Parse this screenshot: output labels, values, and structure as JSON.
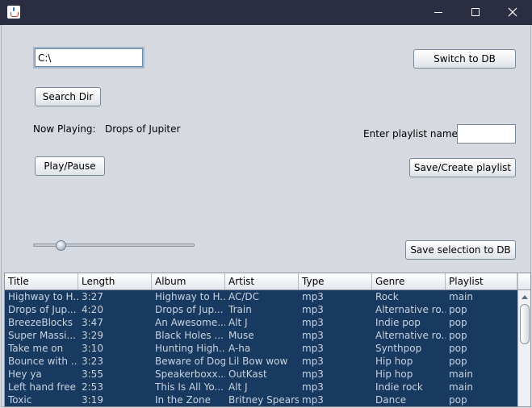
{
  "window": {
    "controls": {
      "minimize_icon": "minimize-icon",
      "maximize_icon": "maximize-icon",
      "close_icon": "close-icon"
    }
  },
  "path_field": {
    "value": "C:\\"
  },
  "buttons": {
    "switch_db": "Switch to DB",
    "search_dir": "Search Dir",
    "play_pause": "Play/Pause",
    "save_playlist": "Save/Create playlist",
    "save_selection": "Save selection to DB"
  },
  "now_playing": {
    "label": "Now Playing:",
    "track": "Drops of Jupiter"
  },
  "playlist_name": {
    "label": "Enter playlist name:",
    "value": ""
  },
  "volume": {
    "level": 0.15
  },
  "table": {
    "columns": [
      "Title",
      "Length",
      "Album",
      "Artist",
      "Type",
      "Genre",
      "Playlist"
    ],
    "rows": [
      [
        "Highway to H...",
        "3:27",
        "Highway to H...",
        "AC/DC",
        "mp3",
        "Rock",
        "main"
      ],
      [
        "Drops of Jup...",
        "4:20",
        "Drops of Jup...",
        "Train",
        "mp3",
        "Alternative ro...",
        "pop"
      ],
      [
        "BreezeBlocks",
        "3:47",
        "An Awesome...",
        "Alt J",
        "mp3",
        "Indie pop",
        "pop"
      ],
      [
        "Super Massi...",
        "3:29",
        "Black Holes ...",
        "Muse",
        "mp3",
        "Alternative ro...",
        "pop"
      ],
      [
        "Take me on",
        "3:10",
        "Hunting High...",
        "A-ha",
        "mp3",
        "Synthpop",
        "pop"
      ],
      [
        "Bounce with ...",
        "3:23",
        "Beware of Dog",
        "Lil Bow wow",
        "mp3",
        "Hip hop",
        "pop"
      ],
      [
        "Hey ya",
        "3:55",
        "Speakerboxx...",
        "OutKast",
        "mp3",
        "Hip hop",
        "main"
      ],
      [
        "Left hand free",
        "2:53",
        "This Is All Yo...",
        "Alt J",
        "mp3",
        "Indie rock",
        "main"
      ],
      [
        "Toxic",
        "3:19",
        "In the Zone",
        "Britney Spears",
        "mp3",
        "Dance",
        "pop"
      ]
    ]
  },
  "colors": {
    "selection_bg": "#183960",
    "selection_text": "#c9d3de",
    "titlebar": "#2b2d42",
    "panel_bg": "#d6d9df"
  }
}
